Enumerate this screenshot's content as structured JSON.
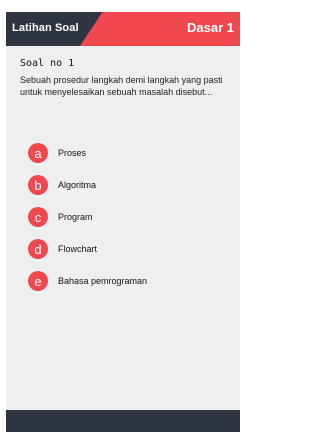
{
  "header": {
    "title": "Latihan Soal",
    "level": "Dasar 1"
  },
  "question": {
    "number": "Soal no 1",
    "text": "Sebuah prosedur langkah demi langkah yang pasti untuk menyelesaikan sebuah masalah disebut..."
  },
  "options": [
    {
      "letter": "a",
      "label": "Proses"
    },
    {
      "letter": "b",
      "label": "Algoritma"
    },
    {
      "letter": "c",
      "label": "Program"
    },
    {
      "letter": "d",
      "label": "Flowchart"
    },
    {
      "letter": "e",
      "label": "Bahasa pemrograman"
    }
  ],
  "colors": {
    "header_dark": "#2f3540",
    "accent_red": "#f0484e",
    "background": "#efefef"
  }
}
